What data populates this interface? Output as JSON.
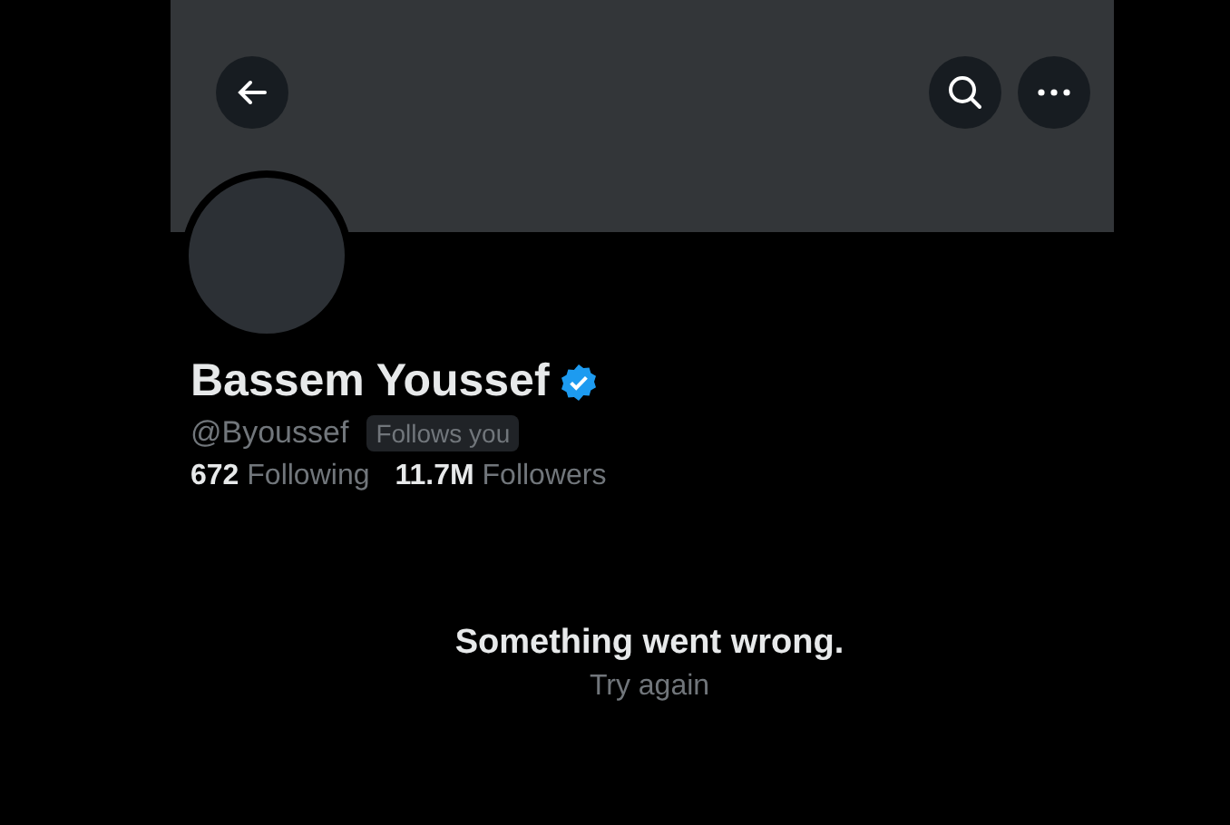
{
  "profile": {
    "name": "Bassem Youssef",
    "verified": true,
    "handle": "@Byoussef",
    "badge": "Follows you",
    "stats": [
      "**672** Following",
      "**11.7M** Followers"
    ]
  },
  "error": {
    "message": "Something went wrong.",
    "action": "Try again"
  }
}
